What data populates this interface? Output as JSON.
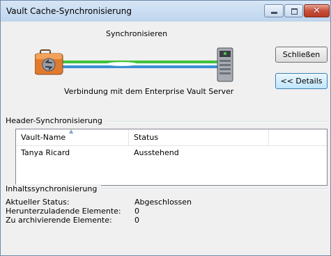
{
  "window": {
    "title": "Vault Cache-Synchronisierung",
    "controls": {
      "minimize": "minimize-icon",
      "maximize": "maximize-icon",
      "close": "close-icon",
      "close_glyph": "✕"
    }
  },
  "sync": {
    "heading": "Synchronisieren",
    "connection_label": "Verbindung mit dem Enterprise Vault Server",
    "client_icon": "briefcase-sync-icon",
    "server_icon": "server-icon"
  },
  "buttons": {
    "close_label": "Schließen",
    "details_label": "<< Details"
  },
  "header_sync": {
    "label": "Header-Synchronisierung",
    "columns": [
      "Vault-Name",
      "Status",
      ""
    ],
    "rows": [
      {
        "vault_name": "Tanya Ricard",
        "status": "Ausstehend"
      }
    ]
  },
  "content_sync": {
    "label": "Inhaltssynchronisierung",
    "items": [
      {
        "label": "Aktueller Status:",
        "value": "Abgeschlossen"
      },
      {
        "label": "Herunterzuladende Elemente:",
        "value": "0"
      },
      {
        "label": "Zu archivierende Elemente:",
        "value": "0"
      }
    ]
  },
  "colors": {
    "line_green": "#3fc23b",
    "line_blue": "#3a8fd6",
    "accent_button": "#3c7fb1",
    "close_red": "#c8503a"
  }
}
